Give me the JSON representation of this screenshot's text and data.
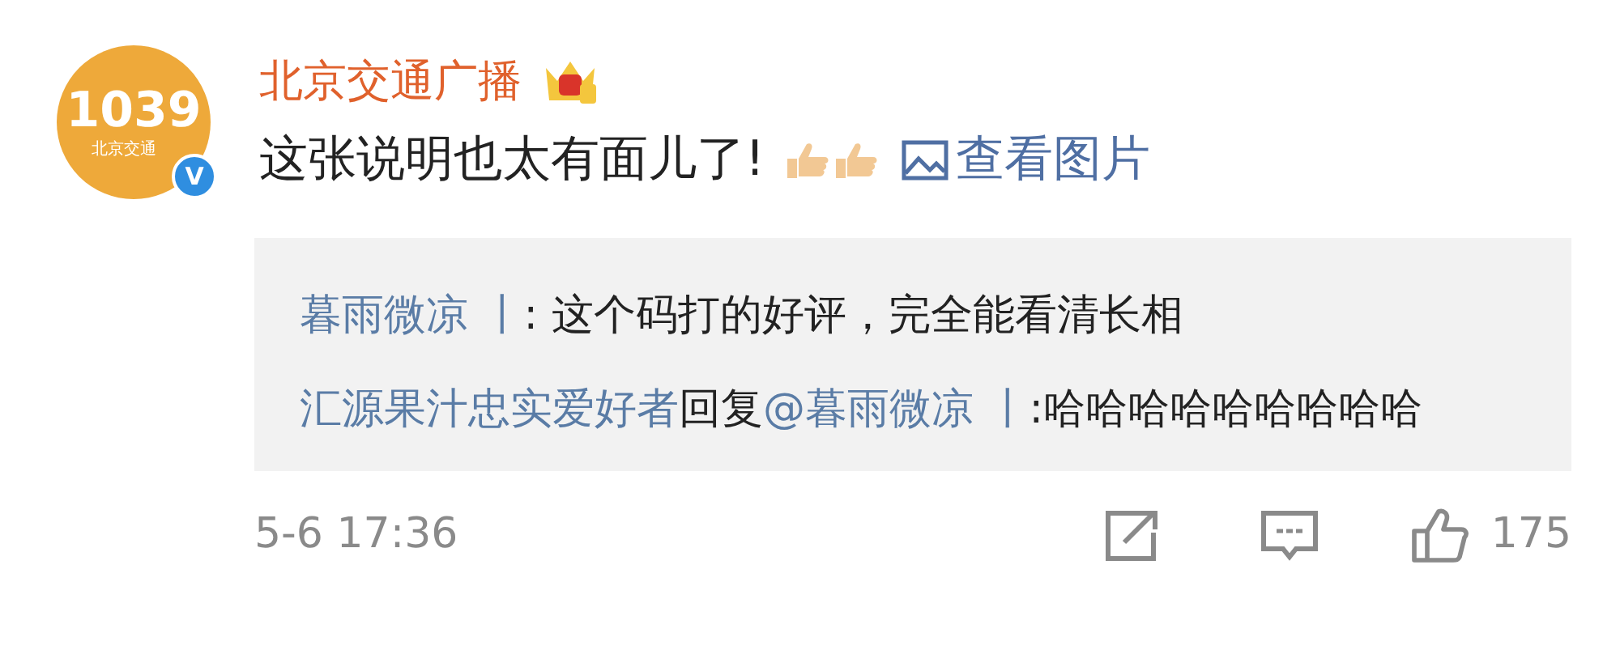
{
  "author": {
    "avatar": {
      "number": "1039",
      "caption": "北京交通"
    },
    "verified_mark": "V",
    "name": "北京交通广播"
  },
  "post": {
    "text": "这张说明也太有面儿了!",
    "link": "查看图片"
  },
  "replies": [
    {
      "segments": [
        {
          "kind": "user",
          "text": "暮雨微凉 丨"
        },
        {
          "kind": "plain",
          "text": ": 这个码打的好评，完全能看清长相"
        }
      ]
    },
    {
      "segments": [
        {
          "kind": "user",
          "text": "汇源果汁忠实爱好者"
        },
        {
          "kind": "plain",
          "text": "回复"
        },
        {
          "kind": "user",
          "text": "@暮雨微凉 丨"
        },
        {
          "kind": "plain",
          "text": ":哈哈哈哈哈哈哈哈哈"
        }
      ]
    }
  ],
  "footer": {
    "time": "5-6 17:36",
    "likes": "175"
  }
}
